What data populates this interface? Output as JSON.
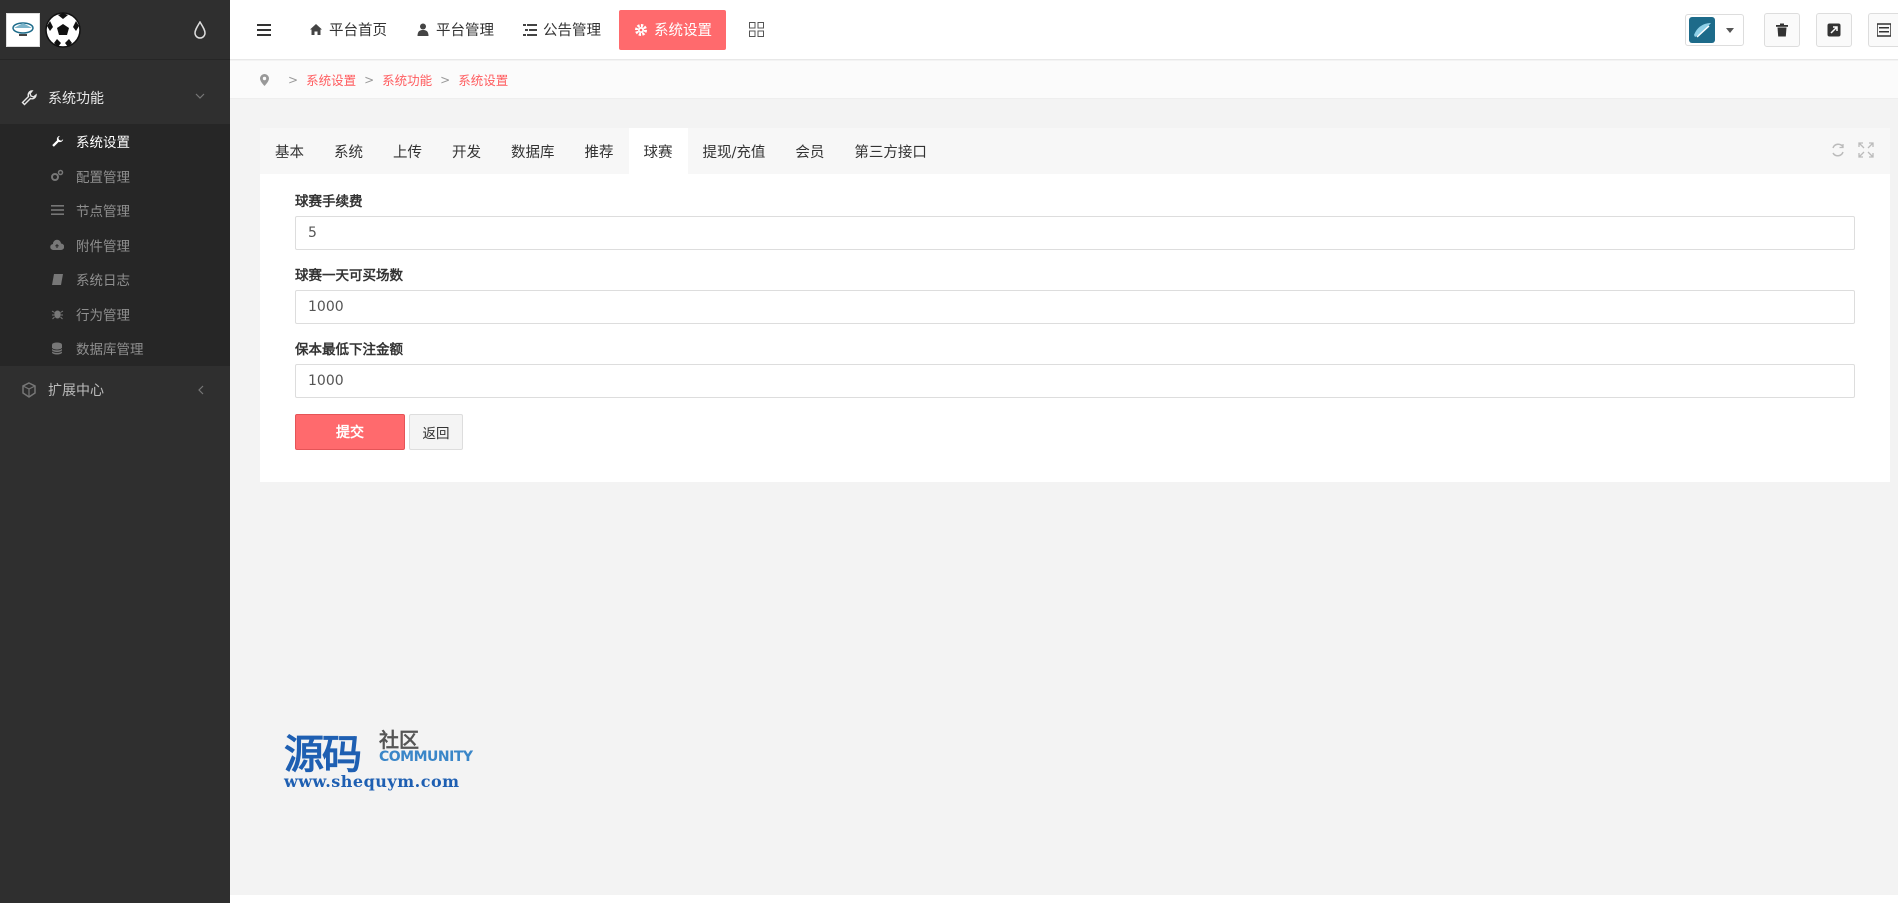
{
  "sidebar": {
    "group_system": "系统功能",
    "items": [
      {
        "label": "系统设置",
        "icon": "wrench-icon",
        "active": true
      },
      {
        "label": "配置管理",
        "icon": "cogs-icon",
        "active": false
      },
      {
        "label": "节点管理",
        "icon": "list-icon",
        "active": false
      },
      {
        "label": "附件管理",
        "icon": "cloud-upload-icon",
        "active": false
      },
      {
        "label": "系统日志",
        "icon": "book-icon",
        "active": false
      },
      {
        "label": "行为管理",
        "icon": "bug-icon",
        "active": false
      },
      {
        "label": "数据库管理",
        "icon": "database-icon",
        "active": false
      }
    ],
    "group_ext": "扩展中心"
  },
  "topnav": {
    "items": [
      {
        "label": "平台首页",
        "icon": "home-icon"
      },
      {
        "label": "平台管理",
        "icon": "user-icon"
      },
      {
        "label": "公告管理",
        "icon": "list-alt-icon"
      },
      {
        "label": "系统设置",
        "icon": "gear-icon",
        "active": true
      }
    ]
  },
  "breadcrumb": [
    "系统设置",
    "系统功能",
    "系统设置"
  ],
  "tabs": [
    "基本",
    "系统",
    "上传",
    "开发",
    "数据库",
    "推荐",
    "球赛",
    "提现/充值",
    "会员",
    "第三方接口"
  ],
  "active_tab": "球赛",
  "form": {
    "fields": [
      {
        "label": "球赛手续费",
        "value": "5"
      },
      {
        "label": "球赛一天可买场数",
        "value": "1000"
      },
      {
        "label": "保本最低下注金额",
        "value": "1000"
      }
    ],
    "submit_label": "提交",
    "back_label": "返回"
  },
  "watermark": {
    "big": "源码",
    "small": "社区",
    "eng": "COMMUNITY",
    "url": "www.shequym.com"
  },
  "colors": {
    "accent": "#ff6a6d",
    "sidebar_bg": "#2f2f2f",
    "link": "#ff5c5f"
  }
}
